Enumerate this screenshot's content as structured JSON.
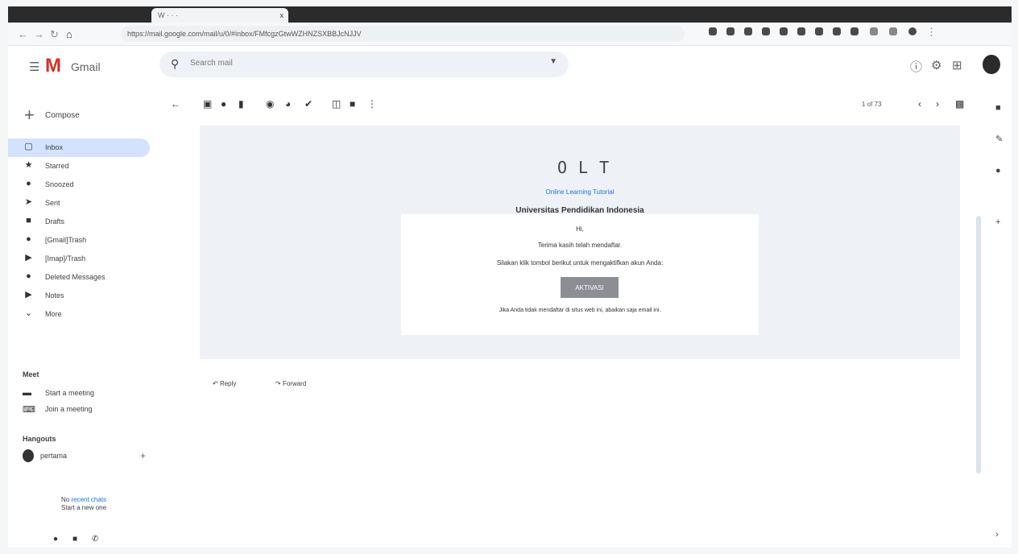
{
  "browser": {
    "tab_title": "W · · ·",
    "tab_close": "x",
    "url": "https://mail.google.com/mail/u/0/#inbox/FMfcgzGtwWZHNZSXBBJcNJJV"
  },
  "gmail": {
    "logo_letter": "M",
    "app_name": "Gmail",
    "search_placeholder": "Search mail"
  },
  "sidebar": {
    "compose": "Compose",
    "items": [
      {
        "label": "Inbox",
        "icon": "inbox-icon",
        "glyph": "▢"
      },
      {
        "label": "Starred",
        "icon": "star-icon",
        "glyph": "★"
      },
      {
        "label": "Snoozed",
        "icon": "clock-icon",
        "glyph": "●"
      },
      {
        "label": "Sent",
        "icon": "send-icon",
        "glyph": "➤"
      },
      {
        "label": "Drafts",
        "icon": "draft-icon",
        "glyph": "■"
      },
      {
        "label": "[Gmail]Trash",
        "icon": "label-icon",
        "glyph": "●"
      },
      {
        "label": "[Imap]/Trash",
        "icon": "label-icon",
        "glyph": "▶"
      },
      {
        "label": "Deleted Messages",
        "icon": "label-icon",
        "glyph": "●"
      },
      {
        "label": "Notes",
        "icon": "label-icon",
        "glyph": "▶"
      },
      {
        "label": "More",
        "icon": "chevron-down-icon",
        "glyph": "⌄"
      }
    ],
    "meet_title": "Meet",
    "meet_new": "Start a meeting",
    "meet_join": "Join a meeting",
    "hangouts_title": "Hangouts",
    "hangouts_user": "pertama",
    "no_recent_prefix": "No",
    "no_recent_link": "recent chats",
    "no_recent_line2": "Start a new one"
  },
  "toolbar": {
    "pager": "1 of 73"
  },
  "email": {
    "logo_text": "OLT",
    "link_text": "Online Learning Tutorial",
    "university": "Universitas Pendidikan Indonesia",
    "greeting": "Hi,",
    "line1": "Terima kasih telah mendaftar.",
    "line2": "Silakan klik tombol berikut untuk mengaktifkan akun Anda:",
    "button": "AKTIVASI",
    "line3": "Jika Anda tidak mendaftar di situs web ini, abaikan saja email ini."
  },
  "actions": {
    "reply": "Reply",
    "forward": "Forward"
  }
}
